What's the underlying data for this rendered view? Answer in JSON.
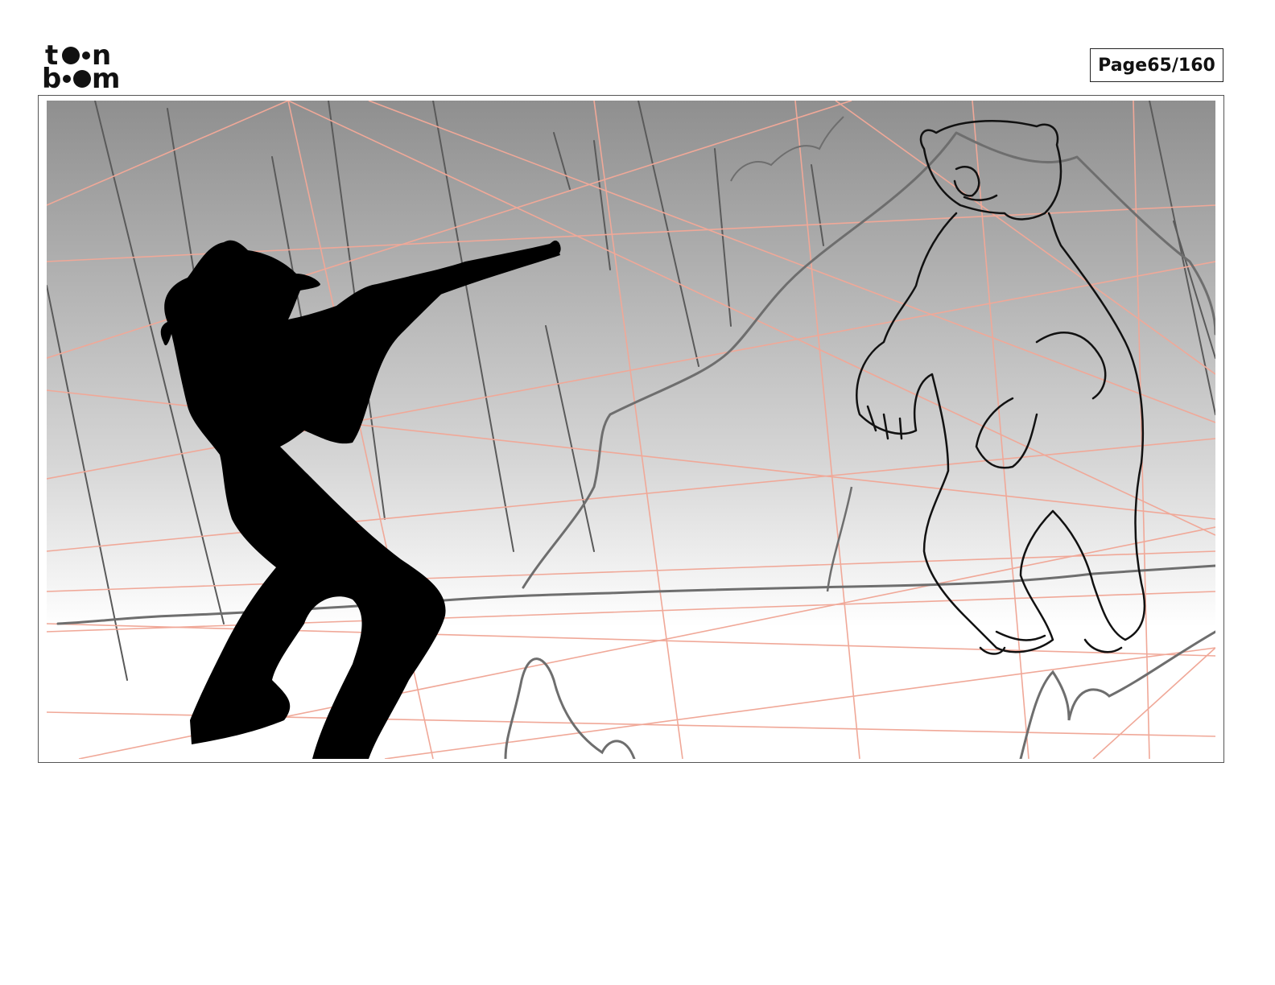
{
  "header": {
    "logo": {
      "line1_start": "t",
      "line1_end": "n",
      "line2_start": "b",
      "line2_end": "m",
      "icon": "toonboom-logo-icon"
    },
    "page_label": "Page",
    "page_current": "65",
    "page_total": "160"
  },
  "panel": {
    "colors": {
      "sky_top": "#8f8f8f",
      "sky_bottom": "#ffffff",
      "guide_lines": "#f0a898",
      "sketch_grey": "#6e6e6e",
      "silhouette": "#000000"
    }
  }
}
